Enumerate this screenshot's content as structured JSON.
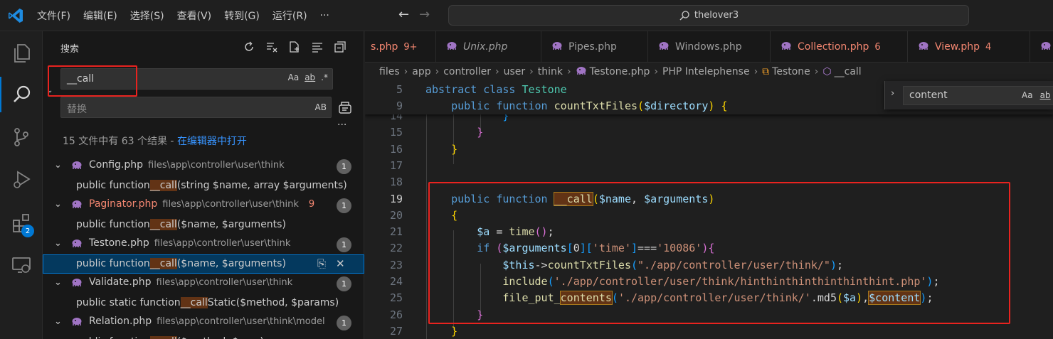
{
  "titlebar": {
    "menu": [
      "文件(F)",
      "编辑(E)",
      "选择(S)",
      "查看(V)",
      "转到(G)",
      "运行(R)",
      "···"
    ],
    "command_center": "thelover3"
  },
  "activity": {
    "extensions_badge": "2"
  },
  "sidebar": {
    "title": "搜索",
    "search_value": "__call",
    "search_options": [
      "Aa",
      "ab",
      ".*"
    ],
    "replace_placeholder": "替换",
    "replace_option": "AB",
    "more": "···",
    "summary_text": "15 文件中有 63 个结果 - ",
    "summary_link": "在编辑器中打开",
    "results": [
      {
        "kind": "file",
        "name": "Config.php",
        "path": "files\\app\\controller\\user\\think",
        "errors": "",
        "count": "1"
      },
      {
        "kind": "match",
        "pre": "public function ",
        "hit": "__call",
        "post": "(string $name, array $arguments)"
      },
      {
        "kind": "file",
        "name": "Paginator.php",
        "path": "files\\app\\controller\\user\\think",
        "errors": "9",
        "count": "1"
      },
      {
        "kind": "match",
        "pre": "public function ",
        "hit": "__call",
        "post": "($name, $arguments)"
      },
      {
        "kind": "file",
        "name": "Testone.php",
        "path": "files\\app\\controller\\user\\think",
        "errors": "",
        "count": "1"
      },
      {
        "kind": "match",
        "pre": "public function ",
        "hit": "__call",
        "post": "($name, $arguments)",
        "selected": true
      },
      {
        "kind": "file",
        "name": "Validate.php",
        "path": "files\\app\\controller\\user\\think",
        "errors": "",
        "count": "1"
      },
      {
        "kind": "match",
        "pre": "public static function ",
        "hit": "__call",
        "post": "Static($method, $params)"
      },
      {
        "kind": "file",
        "name": "Relation.php",
        "path": "files\\app\\controller\\user\\think\\model",
        "errors": "",
        "count": "1"
      },
      {
        "kind": "match",
        "pre": "public function ",
        "hit": "__call",
        "post": "($method, $args)"
      }
    ]
  },
  "tabs": [
    {
      "name": "s.php",
      "count": "9+",
      "err": true,
      "italic": false
    },
    {
      "name": "Unix.php",
      "count": "",
      "err": false,
      "italic": true
    },
    {
      "name": "Pipes.php",
      "count": "",
      "err": false,
      "italic": false
    },
    {
      "name": "Windows.php",
      "count": "",
      "err": false,
      "italic": false
    },
    {
      "name": "Collection.php",
      "count": "6",
      "err": true,
      "italic": false
    },
    {
      "name": "View.php",
      "count": "4",
      "err": true,
      "italic": false
    },
    {
      "name": "",
      "count": "",
      "err": false,
      "italic": false
    }
  ],
  "breadcrumb": [
    "files",
    "app",
    "controller",
    "user",
    "think",
    "Testone.php",
    "PHP Intelephense",
    "Testone",
    "__call"
  ],
  "find_widget": {
    "value": "content",
    "options": [
      "Aa",
      "ab"
    ]
  },
  "editor": {
    "sticky": [
      {
        "n": "5",
        "tokens": [
          [
            "k",
            "abstract "
          ],
          [
            "k",
            "class "
          ],
          [
            "c",
            "Testone"
          ]
        ]
      },
      {
        "n": "9",
        "tokens": [
          [
            "p",
            "    "
          ],
          [
            "k",
            "public "
          ],
          [
            "k",
            "function "
          ],
          [
            "f",
            "countTxtFiles"
          ],
          [
            "b1",
            "("
          ],
          [
            "v",
            "$directory"
          ],
          [
            "b1",
            ")"
          ],
          [
            "p",
            " "
          ],
          [
            "b1",
            "{"
          ]
        ]
      }
    ],
    "lines": [
      {
        "n": "14",
        "tokens": [
          [
            "p",
            "            "
          ],
          [
            "b3",
            "}"
          ]
        ]
      },
      {
        "n": "15",
        "tokens": [
          [
            "p",
            "        "
          ],
          [
            "b2",
            "}"
          ]
        ]
      },
      {
        "n": "16",
        "tokens": [
          [
            "p",
            "    "
          ],
          [
            "b1",
            "}"
          ]
        ]
      },
      {
        "n": "17",
        "tokens": []
      },
      {
        "n": "18",
        "tokens": []
      },
      {
        "n": "19",
        "cur": true,
        "tokens": [
          [
            "p",
            "    "
          ],
          [
            "k",
            "public "
          ],
          [
            "k",
            "function "
          ],
          [
            "mf",
            "__call"
          ],
          [
            "b1",
            "("
          ],
          [
            "v",
            "$name"
          ],
          [
            "p",
            ", "
          ],
          [
            "v",
            "$arguments"
          ],
          [
            "b1",
            ")"
          ]
        ]
      },
      {
        "n": "20",
        "tokens": [
          [
            "p",
            "    "
          ],
          [
            "b1",
            "{"
          ]
        ]
      },
      {
        "n": "21",
        "tokens": [
          [
            "p",
            "        "
          ],
          [
            "v",
            "$a"
          ],
          [
            "p",
            " = "
          ],
          [
            "f",
            "time"
          ],
          [
            "b2",
            "()"
          ],
          [
            "p",
            ";"
          ]
        ]
      },
      {
        "n": "22",
        "tokens": [
          [
            "p",
            "        "
          ],
          [
            "k",
            "if "
          ],
          [
            "b2",
            "("
          ],
          [
            "v",
            "$arguments"
          ],
          [
            "b3",
            "["
          ],
          [
            "p",
            "0"
          ],
          [
            "b3",
            "]"
          ],
          [
            "b3",
            "["
          ],
          [
            "s",
            "'time'"
          ],
          [
            "b3",
            "]"
          ],
          [
            "p",
            "==="
          ],
          [
            "s",
            "'10086'"
          ],
          [
            "b2",
            ")"
          ],
          [
            "b2",
            "{"
          ]
        ]
      },
      {
        "n": "23",
        "tokens": [
          [
            "p",
            "            "
          ],
          [
            "v",
            "$this"
          ],
          [
            "p",
            "->"
          ],
          [
            "f",
            "countTxtFiles"
          ],
          [
            "b3",
            "("
          ],
          [
            "s",
            "\"./app/controller/user/think/\""
          ],
          [
            "b3",
            ")"
          ],
          [
            "p",
            ";"
          ]
        ]
      },
      {
        "n": "24",
        "tokens": [
          [
            "p",
            "            "
          ],
          [
            "f",
            "include"
          ],
          [
            "b3",
            "("
          ],
          [
            "s",
            "'./app/controller/user/think/hinthinthinthinthinthint.php'"
          ],
          [
            "b3",
            ")"
          ],
          [
            "p",
            ";"
          ]
        ]
      },
      {
        "n": "25",
        "tokens": [
          [
            "p",
            "            "
          ],
          [
            "f",
            "file_put_"
          ],
          [
            "mf",
            "contents"
          ],
          [
            "b3",
            "("
          ],
          [
            "s",
            "'./app/controller/user/think/'"
          ],
          [
            "p",
            ".md5"
          ],
          [
            "b1",
            "("
          ],
          [
            "v",
            "$a"
          ],
          [
            "b1",
            ")"
          ],
          [
            "p",
            ","
          ],
          [
            "mv",
            "$content"
          ],
          [
            "b3",
            ")"
          ],
          [
            "p",
            ";"
          ]
        ]
      },
      {
        "n": "26",
        "tokens": [
          [
            "p",
            "        "
          ],
          [
            "b2",
            "}"
          ]
        ]
      },
      {
        "n": "27",
        "tokens": [
          [
            "p",
            "    "
          ],
          [
            "b1",
            "}"
          ]
        ]
      }
    ]
  }
}
